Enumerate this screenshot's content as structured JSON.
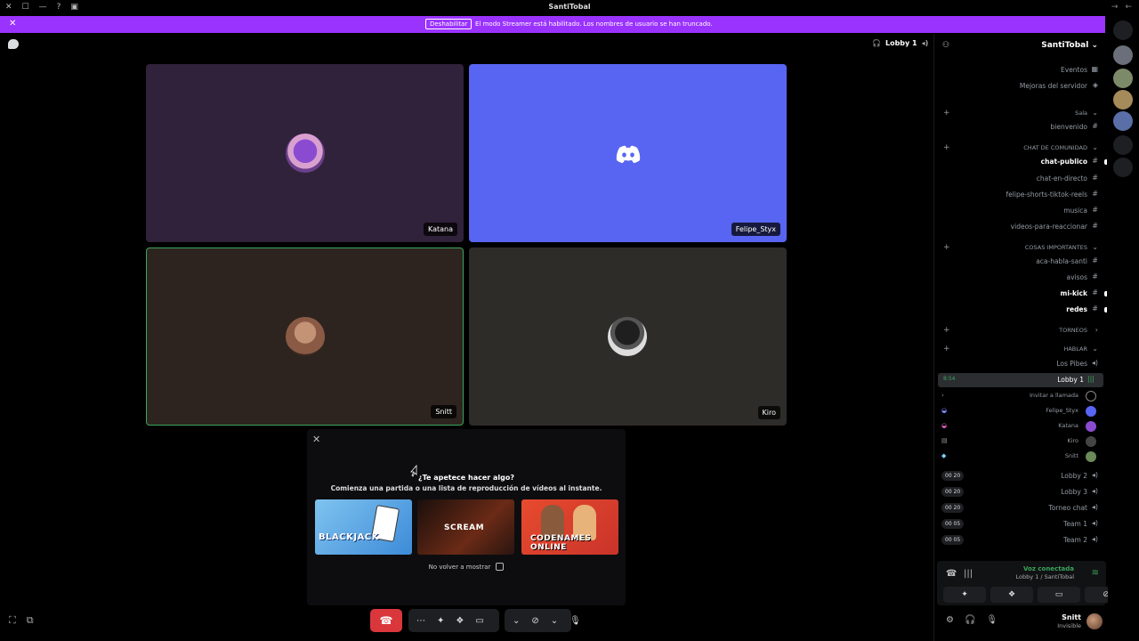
{
  "window": {
    "title": "SantiTobal"
  },
  "banner": {
    "button_label": "Deshabilitar",
    "message": "El modo Streamer está habilitado. Los nombres de usuario se han truncado."
  },
  "call": {
    "channel_name": "Lobby 1",
    "tiles": [
      {
        "name": "Katana",
        "avatar_color": "#8b4bd1"
      },
      {
        "name": "Felipe_Styx",
        "avatar_color": "#5865f2"
      },
      {
        "name": "Snitt",
        "avatar_color": "#b78767"
      },
      {
        "name": "Kiro",
        "avatar_color": "#1f1f1f"
      }
    ]
  },
  "activity": {
    "question": "¿Te apetece hacer algo?",
    "subtitle": "Comienza una partida o una lista de reproducción de vídeos al instante.",
    "games": [
      {
        "label": "BLACKJACK"
      },
      {
        "label": "SCREAM"
      },
      {
        "label": "CODENAMES ONLINE"
      }
    ],
    "dont_show": "No volver a mostrar"
  },
  "sidebar": {
    "server_name": "SantiTobal",
    "items": [
      {
        "label": "Eventos"
      },
      {
        "label": "Mejoras del servidor"
      },
      {
        "label": "Sala"
      },
      {
        "label": "bienvenido"
      },
      {
        "label": "CHAT DE COMUNIDAD"
      },
      {
        "label": "chat-publico"
      },
      {
        "label": "chat-en-directo"
      },
      {
        "label": "felipe-shorts-tiktok-reels"
      },
      {
        "label": "musica"
      },
      {
        "label": "videos-para-reaccionar"
      },
      {
        "label": "COSAS IMPORTANTES"
      },
      {
        "label": "aca-habla-santi"
      },
      {
        "label": "avisos"
      },
      {
        "label": "mi-kick"
      },
      {
        "label": "redes"
      },
      {
        "label": "TORNEOS"
      },
      {
        "label": "HABLAR"
      },
      {
        "label": "Los Pibes"
      },
      {
        "label": "Lobby 1"
      },
      {
        "label": "Invitar a llamada"
      },
      {
        "label": "Felipe_Styx"
      },
      {
        "label": "Katana"
      },
      {
        "label": "Kiro"
      },
      {
        "label": "Snitt"
      },
      {
        "label": "Lobby 2"
      },
      {
        "label": "Lobby 3"
      },
      {
        "label": "Torneo chat"
      },
      {
        "label": "Team 1"
      },
      {
        "label": "Team 2"
      }
    ],
    "lobby1_time": "8:54",
    "counts": [
      "00  20",
      "00  20",
      "00  20",
      "00  05",
      "00  05"
    ]
  },
  "voice": {
    "status": "Voz conectada",
    "location": "Lobby 1 / SantiTobal"
  },
  "user": {
    "name": "Snitt",
    "status": "Invisible"
  },
  "colors": {
    "accent": "#5865f2",
    "banner": "#9b33ff",
    "danger": "#da373c",
    "online": "#3ba55c"
  }
}
